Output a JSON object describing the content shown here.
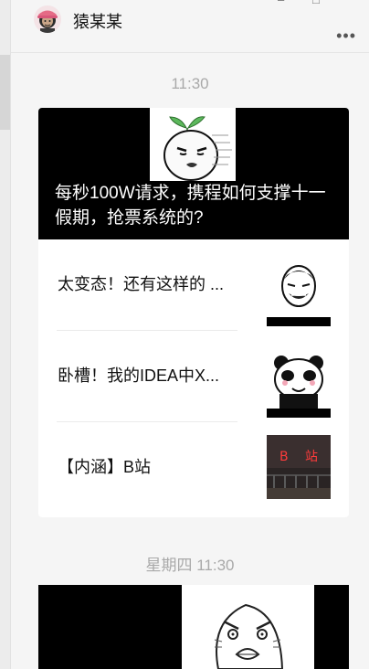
{
  "chat": {
    "contact_name": "猿某某",
    "window_controls": [
      "⌃",
      "–",
      "□"
    ],
    "more_icon": "more-dots-icon"
  },
  "messages": [
    {
      "time": "11:30",
      "articles": {
        "cover_title": "每秒100W请求，携程如何支撑十一假期，抢票系统的?",
        "items": [
          {
            "title": "太变态！还有这样的 ..."
          },
          {
            "title": "卧槽！我的IDEA中X..."
          },
          {
            "title": "【内涵】B站"
          }
        ]
      }
    },
    {
      "time": "星期四 11:30"
    }
  ]
}
